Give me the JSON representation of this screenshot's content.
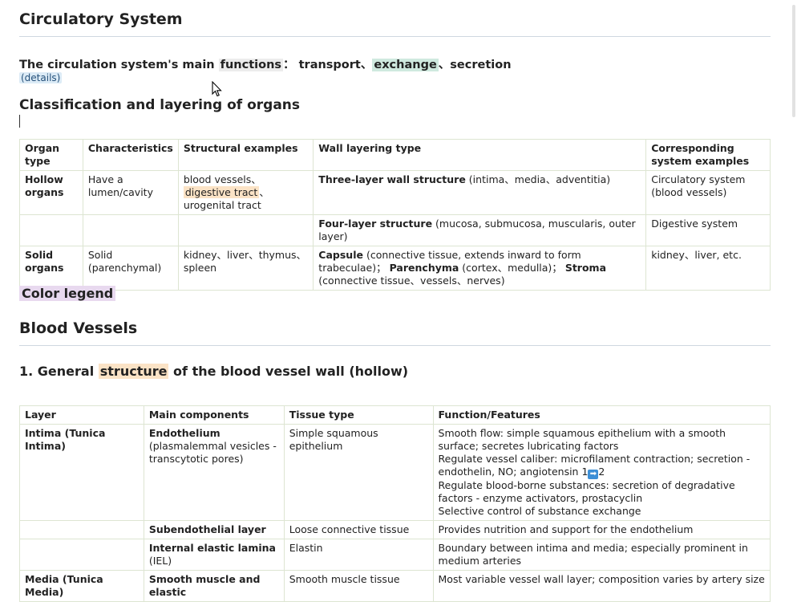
{
  "title": "Circulatory System",
  "functions_line": {
    "prefix": "The circulation system's main ",
    "functions": "functions",
    "colon": "：",
    "transport": "transport",
    "sep1": "、",
    "exchange": "exchange",
    "sep2": "、",
    "secretion": "secretion"
  },
  "details_link": "(details)",
  "classification_heading": "Classification and layering of organs",
  "organ_table": {
    "headers": [
      "Organ type",
      "Characteristics",
      "Structural examples",
      "Wall layering type",
      "Corresponding system examples"
    ],
    "row1": {
      "type": "Hollow organs",
      "characteristics": "Have a lumen/cavity",
      "examples_a": "blood vessels、",
      "examples_hl": "digestive tract",
      "examples_b": "、urogenital tract",
      "layer_bold": "Three-layer wall structure",
      "layer_rest": " (intima、media、adventitia)",
      "system": "Circulatory system (blood vessels)"
    },
    "row2": {
      "layer_bold": "Four-layer structure",
      "layer_rest": " (mucosa, submucosa, muscularis, outer layer)",
      "system": "Digestive system"
    },
    "row3": {
      "type": "Solid organs",
      "characteristics": "Solid (parenchymal)",
      "examples": "kidney、liver、thymus、spleen",
      "capsule_bold": "Capsule",
      "capsule_rest": " (connective tissue, extends inward to form trabeculae)；",
      "parenchyma_bold": "Parenchyma",
      "parenchyma_rest": " (cortex、medulla)；",
      "stroma_bold": "Stroma",
      "stroma_rest": "　 (connective tissue、vessels、nerves)",
      "system": "kidney、liver, etc."
    }
  },
  "color_legend": "Color legend",
  "blood_vessels_heading": "Blood Vessels",
  "section1": {
    "number": "1. General ",
    "highlight": "structure",
    "rest": " of the blood vessel wall (hollow)"
  },
  "vessel_table": {
    "headers": [
      "Layer",
      "Main components",
      "Tissue type",
      "Function/Features"
    ],
    "intima": {
      "layer": "Intima (Tunica Intima)",
      "endo_bold": "Endothelium",
      "endo_rest": "(plasmalemmal vesicles -transcytotic pores)",
      "endo_tissue": "Simple squamous epithelium",
      "f1": "Smooth flow: simple squamous epithelium with a smooth surface; secretes lubricating factors",
      "f2a": "Regulate vessel caliber: microfilament contraction; secretion - endothelin, NO; angiotensin 1",
      "f2arrow": "➡",
      "f2b": "2",
      "f3": "Regulate blood-borne substances: secretion of degradative factors - enzyme activators, prostacyclin",
      "f4": "Selective control of substance exchange",
      "sub_bold": "Subendothelial layer",
      "sub_tissue": "Loose connective tissue",
      "sub_func": "Provides nutrition and support for the endothelium",
      "iel_bold": "Internal elastic lamina",
      "iel_rest": "(IEL)",
      "iel_tissue": "Elastin",
      "iel_func": "Boundary between intima and media; especially prominent in medium arteries"
    },
    "media_partial": {
      "layer": "Media (Tunica Media)",
      "component": "Smooth muscle and elastic",
      "tissue": "Smooth muscle tissue",
      "func": "Most variable vessel wall layer; composition varies by artery size"
    }
  }
}
